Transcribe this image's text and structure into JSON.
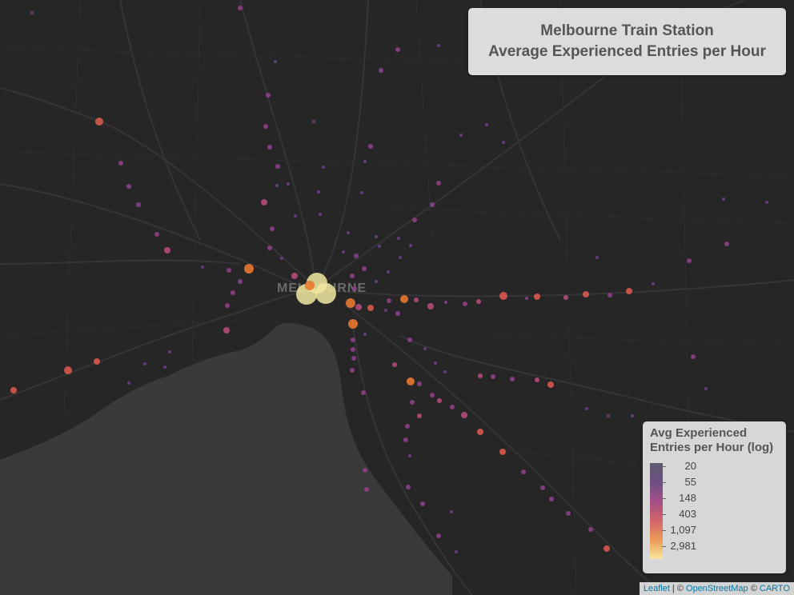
{
  "title": {
    "line1": "Melbourne Train Station",
    "line2": "Average Experienced Entries per Hour"
  },
  "map_label": "MELBOURNE",
  "legend": {
    "title_line1": "Avg Experienced",
    "title_line2": "Entries per Hour (log)",
    "ticks": [
      "20",
      "55",
      "148",
      "403",
      "1,097",
      "2,981"
    ],
    "scale": "log",
    "colors": [
      "#5b5b6b",
      "#6f4f86",
      "#a24f86",
      "#d2656b",
      "#eb9a56",
      "#f6e89c"
    ]
  },
  "attribution": {
    "leaflet": "Leaflet",
    "sep1": " | © ",
    "osm": "OpenStreetMap",
    "sep2": " © ",
    "carto": "CARTO"
  },
  "colors": {
    "land": "#262627",
    "water": "#3a3a3b",
    "roads": "#323234",
    "main_roads": "#3b3b3d"
  }
}
